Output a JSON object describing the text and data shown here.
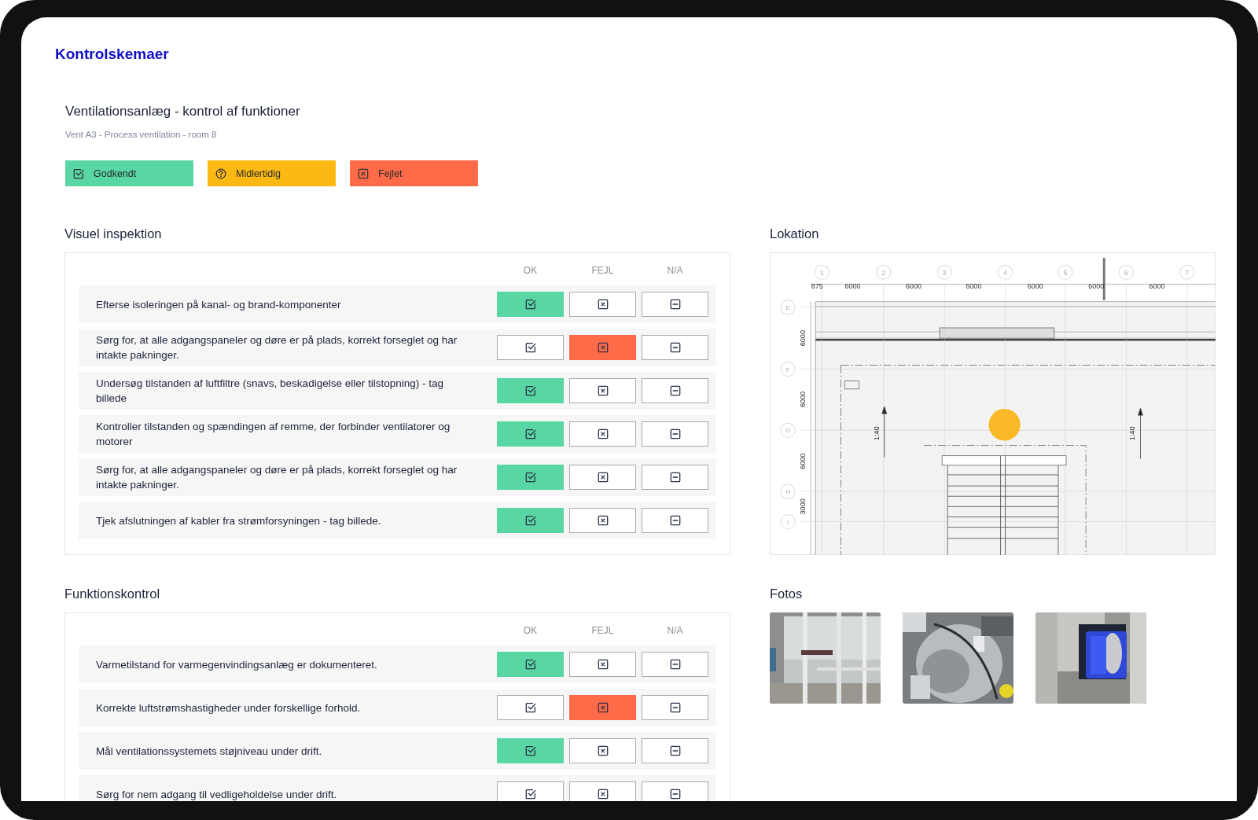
{
  "app": {
    "title": "Kontrolskemaer"
  },
  "form": {
    "title": "Ventilationsanlæg - kontrol af funktioner",
    "subtitle": "Vent A3 - Process ventilation - room 8"
  },
  "status_legend": [
    {
      "kind": "approved",
      "label": "Godkendt"
    },
    {
      "kind": "pending",
      "label": "Midlertidig"
    },
    {
      "kind": "failed",
      "label": "Fejlet"
    }
  ],
  "sections": [
    {
      "title": "Visuel inspektion",
      "columns": [
        {
          "kind": "ok",
          "label": "OK"
        },
        {
          "kind": "fail",
          "label": "FEJL"
        },
        {
          "kind": "na",
          "label": "N/A"
        }
      ],
      "rows": [
        {
          "text": "Efterse isoleringen på kanal- og brand-komponenter",
          "options": [
            {
              "selected": true
            },
            {
              "selected": false
            },
            {
              "selected": false
            }
          ]
        },
        {
          "text": "Sørg for, at alle adgangspaneler og døre er på plads, korrekt forseglet og har intakte pakninger.",
          "options": [
            {
              "selected": false
            },
            {
              "selected": true
            },
            {
              "selected": false
            }
          ]
        },
        {
          "text": "Undersøg tilstanden af luftfiltre (snavs, beskadigelse eller tilstopning) - tag billede",
          "options": [
            {
              "selected": true
            },
            {
              "selected": false
            },
            {
              "selected": false
            }
          ]
        },
        {
          "text": "Kontroller tilstanden og spændingen af remme, der forbinder ventilatorer og motorer",
          "options": [
            {
              "selected": true
            },
            {
              "selected": false
            },
            {
              "selected": false
            }
          ]
        },
        {
          "text": "Sørg for, at alle adgangspaneler og døre er på plads, korrekt forseglet og har intakte pakninger.",
          "options": [
            {
              "selected": true
            },
            {
              "selected": false
            },
            {
              "selected": false
            }
          ]
        },
        {
          "text": "Tjek afslutningen af kabler fra strømforsyningen - tag billede.",
          "options": [
            {
              "selected": true
            },
            {
              "selected": false
            },
            {
              "selected": false
            }
          ]
        }
      ]
    },
    {
      "title": "Funktionskontrol",
      "columns": [
        {
          "kind": "ok",
          "label": "OK"
        },
        {
          "kind": "fail",
          "label": "FEJL"
        },
        {
          "kind": "na",
          "label": "N/A"
        }
      ],
      "rows": [
        {
          "text": "Varmetilstand for varmegenvindingsanlæg er dokumenteret.",
          "options": [
            {
              "selected": true
            },
            {
              "selected": false
            },
            {
              "selected": false
            }
          ]
        },
        {
          "text": "Korrekte luftstrømshastigheder under forskellige forhold.",
          "options": [
            {
              "selected": false
            },
            {
              "selected": true
            },
            {
              "selected": false
            }
          ]
        },
        {
          "text": "Mål ventilationssystemets støjniveau under drift.",
          "options": [
            {
              "selected": true
            },
            {
              "selected": false
            },
            {
              "selected": false
            }
          ]
        },
        {
          "text": "Sørg for nem adgang til vedligeholdelse under drift.",
          "options": [
            {
              "selected": false
            },
            {
              "selected": false
            },
            {
              "selected": false
            }
          ]
        }
      ]
    }
  ],
  "location": {
    "title": "Lokation",
    "plan": {
      "grid_columns": [
        "1",
        "2",
        "3",
        "4",
        "5",
        "6",
        "7"
      ],
      "grid_rows": [
        "E",
        "F",
        "G",
        "H",
        "I"
      ],
      "top_dimensions": [
        "875",
        "6000",
        "6000",
        "6000",
        "6000",
        "6000",
        "6000"
      ],
      "side_dimensions": [
        "6000",
        "6000",
        "6000",
        "3000"
      ],
      "scale_labels": [
        "1:40",
        "1:40"
      ]
    }
  },
  "photos": {
    "title": "Fotos"
  }
}
